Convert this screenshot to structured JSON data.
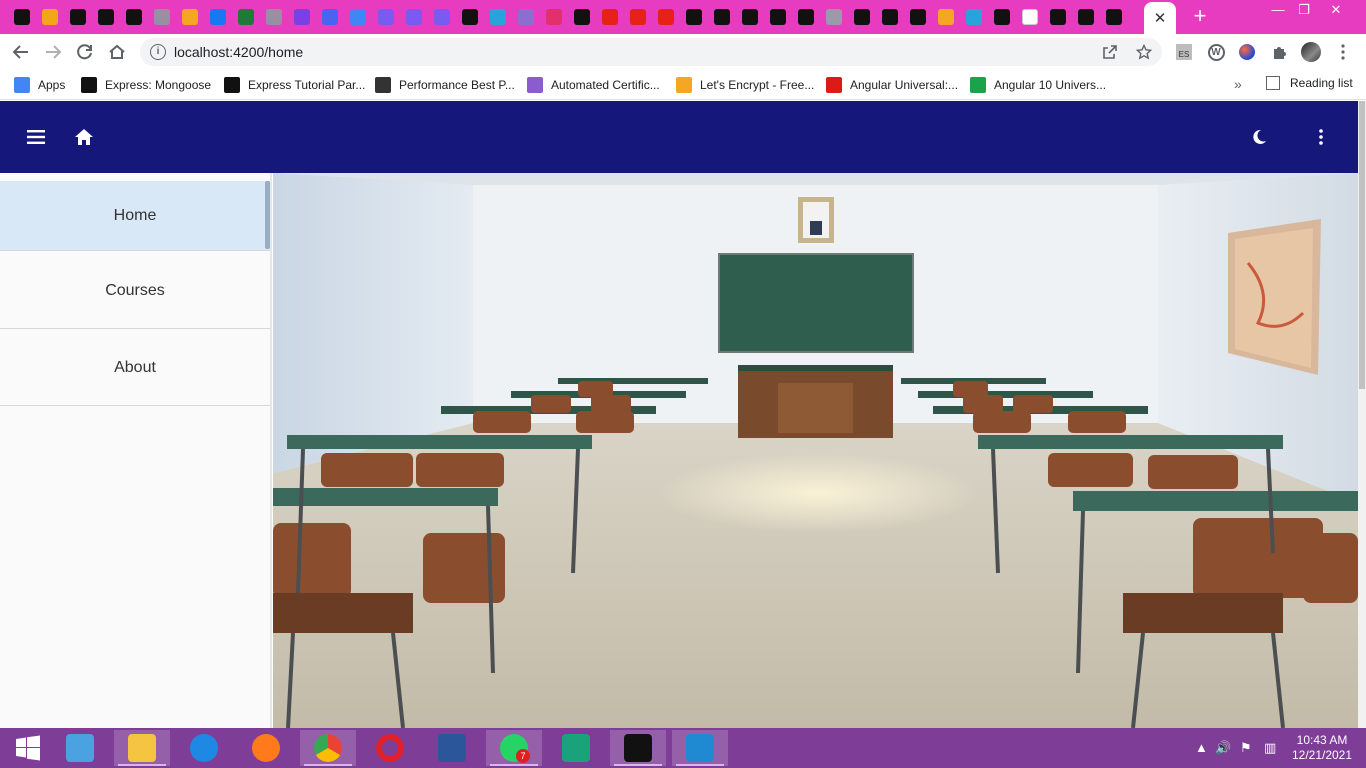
{
  "browser": {
    "url": "localhost:4200/home",
    "tab_favicons": [
      {
        "icon": "camera-shield-icon",
        "color": "#111111"
      },
      {
        "icon": "colorful-icon",
        "color": "#f2a618"
      },
      {
        "icon": "hexagon-icon",
        "color": "#111111"
      },
      {
        "icon": "camera-shield-icon",
        "color": "#111111"
      },
      {
        "icon": "medium-icon",
        "color": "#111111"
      },
      {
        "icon": "globe-icon",
        "color": "#9a8fa0"
      },
      {
        "icon": "chart-icon",
        "color": "#f5a623"
      },
      {
        "icon": "facebook-icon",
        "color": "#1877f2"
      },
      {
        "icon": "leaf-icon",
        "color": "#1f7a3a"
      },
      {
        "icon": "globe-icon",
        "color": "#9a8fa0"
      },
      {
        "icon": "mail-icon",
        "color": "#7b3fe4"
      },
      {
        "icon": "settings-icon",
        "color": "#4a63f0"
      },
      {
        "icon": "docs-icon",
        "color": "#4285f4"
      },
      {
        "icon": "generic-icon",
        "color": "#7a5af0"
      },
      {
        "icon": "generic-icon",
        "color": "#7a5af0"
      },
      {
        "icon": "generic-icon",
        "color": "#7a5af0"
      },
      {
        "icon": "github-icon",
        "color": "#111111"
      },
      {
        "icon": "c-icon",
        "color": "#29a3d9"
      },
      {
        "icon": "chat-icon",
        "color": "#8a6fd1"
      },
      {
        "icon": "instagram-icon",
        "color": "#e1306c"
      },
      {
        "icon": "tw-icon",
        "color": "#111111"
      },
      {
        "icon": "play-icon",
        "color": "#e62117"
      },
      {
        "icon": "play-icon",
        "color": "#e62117"
      },
      {
        "icon": "play-icon",
        "color": "#e62117"
      },
      {
        "icon": "github-icon",
        "color": "#111111"
      },
      {
        "icon": "x-circle-icon",
        "color": "#111111"
      },
      {
        "icon": "codepen-icon",
        "color": "#111111"
      },
      {
        "icon": "github-icon",
        "color": "#111111"
      },
      {
        "icon": "github-icon",
        "color": "#111111"
      },
      {
        "icon": "h-icon",
        "color": "#9a9aa8"
      },
      {
        "icon": "medium-icon",
        "color": "#111111"
      },
      {
        "icon": "github-icon",
        "color": "#111111"
      },
      {
        "icon": "infinity-icon",
        "color": "#111111"
      },
      {
        "icon": "firebase-icon",
        "color": "#f5a623"
      },
      {
        "icon": "chat-icon",
        "color": "#29a3d9"
      },
      {
        "icon": "medium-icon",
        "color": "#111111"
      },
      {
        "icon": "google-icon",
        "color": "#ffffff"
      },
      {
        "icon": "hexagon-icon",
        "color": "#111111"
      },
      {
        "icon": "l-icon",
        "color": "#111111"
      },
      {
        "icon": "github-icon",
        "color": "#111111"
      }
    ]
  },
  "bookmarks": [
    {
      "label": "Apps",
      "icon": "apps-grid-icon",
      "color": "#4285f4"
    },
    {
      "label": "Express: Mongoose",
      "icon": "camera-shield-icon",
      "color": "#111111"
    },
    {
      "label": "Express Tutorial Par...",
      "icon": "camera-shield-icon",
      "color": "#111111"
    },
    {
      "label": "Performance Best P...",
      "icon": "ex-icon",
      "color": "#333333"
    },
    {
      "label": "Automated Certific...",
      "icon": "h-icon",
      "color": "#8a5cd0"
    },
    {
      "label": "Let's Encrypt - Free...",
      "icon": "encrypt-icon",
      "color": "#f5a623"
    },
    {
      "label": "Angular Universal:...",
      "icon": "angular-icon",
      "color": "#dd1b16"
    },
    {
      "label": "Angular 10 Univers...",
      "icon": "djam-icon",
      "color": "#1aa34a"
    }
  ],
  "bookmarks_more": "»",
  "reading_list": "Reading list",
  "app": {
    "header_color": "#16177a",
    "nav": [
      {
        "label": "Home",
        "active": true
      },
      {
        "label": "Courses",
        "active": false
      },
      {
        "label": "About",
        "active": false
      }
    ]
  },
  "taskbar": {
    "apps": [
      {
        "icon": "calculator-icon"
      },
      {
        "icon": "file-explorer-icon"
      },
      {
        "icon": "internet-explorer-icon"
      },
      {
        "icon": "firefox-icon"
      },
      {
        "icon": "chrome-icon"
      },
      {
        "icon": "opera-icon"
      },
      {
        "icon": "word-icon"
      },
      {
        "icon": "whatsapp-icon"
      },
      {
        "icon": "maps-icon"
      },
      {
        "icon": "terminal-icon"
      },
      {
        "icon": "vscode-icon"
      }
    ],
    "whatsapp_badge": "7",
    "time": "10:43 AM",
    "date": "12/21/2021"
  }
}
